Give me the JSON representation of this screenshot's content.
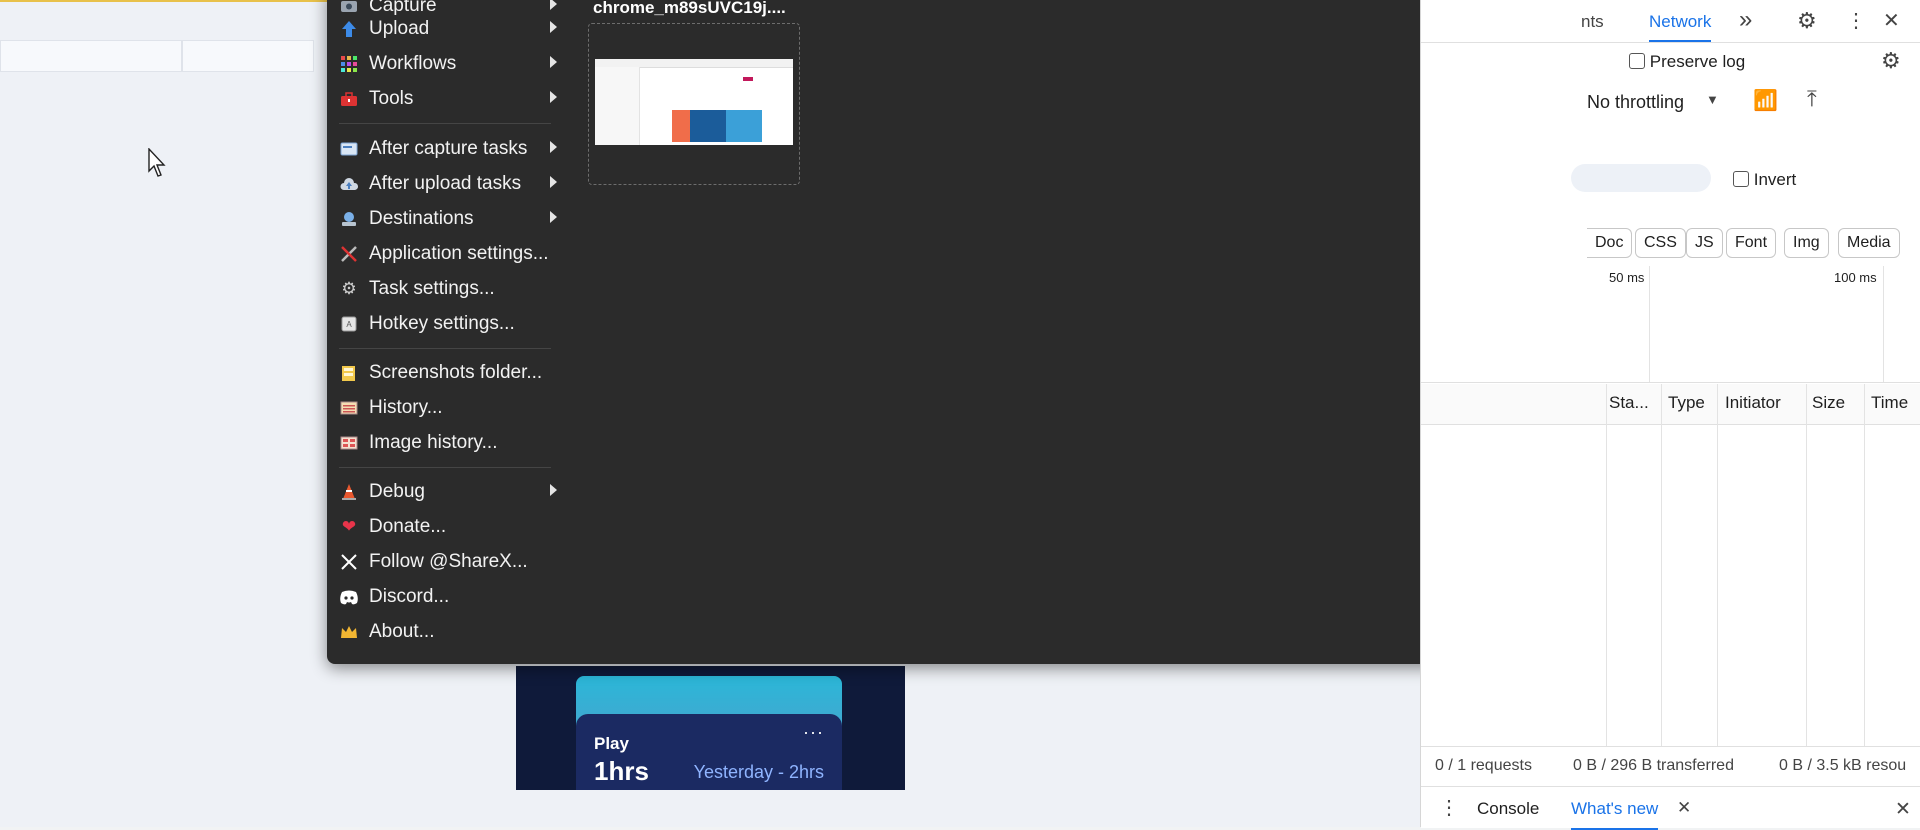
{
  "sharex_menu": {
    "items": [
      {
        "label": "Capture",
        "icon": "capture-icon",
        "submenu": true
      },
      {
        "label": "Upload",
        "icon": "upload-arrow-icon",
        "submenu": true
      },
      {
        "label": "Workflows",
        "icon": "workflows-grid-icon",
        "submenu": true
      },
      {
        "label": "Tools",
        "icon": "toolbox-icon",
        "submenu": true
      },
      {
        "label": "After capture tasks",
        "icon": "after-capture-icon",
        "submenu": true
      },
      {
        "label": "After upload tasks",
        "icon": "after-upload-cloud-icon",
        "submenu": true
      },
      {
        "label": "Destinations",
        "icon": "destinations-icon",
        "submenu": true
      },
      {
        "label": "Application settings...",
        "icon": "wrench-screwdriver-icon",
        "submenu": false
      },
      {
        "label": "Task settings...",
        "icon": "gear-icon",
        "submenu": false
      },
      {
        "label": "Hotkey settings...",
        "icon": "keyboard-key-icon",
        "submenu": false
      },
      {
        "label": "Screenshots folder...",
        "icon": "folder-icon",
        "submenu": false
      },
      {
        "label": "History...",
        "icon": "history-icon",
        "submenu": false
      },
      {
        "label": "Image history...",
        "icon": "image-history-icon",
        "submenu": false
      },
      {
        "label": "Debug",
        "icon": "debug-cone-icon",
        "submenu": true
      },
      {
        "label": "Donate...",
        "icon": "heart-icon",
        "submenu": false
      },
      {
        "label": "Follow @ShareX...",
        "icon": "x-logo-icon",
        "submenu": false
      },
      {
        "label": "Discord...",
        "icon": "discord-icon",
        "submenu": false
      },
      {
        "label": "About...",
        "icon": "crown-icon",
        "submenu": false
      }
    ],
    "thumbnail_title": "chrome_m89sUVC19j...."
  },
  "game_card": {
    "title": "Play",
    "hours": "1hrs",
    "yesterday": "Yesterday - 2hrs",
    "more": "···"
  },
  "devtools": {
    "tab_partial": "nts",
    "tab_network": "Network",
    "more_tabs": "»",
    "preserve_log": "Preserve log",
    "throttling": "No throttling",
    "invert": "Invert",
    "filter_chips": [
      "Doc",
      "CSS",
      "JS",
      "Font",
      "Img",
      "Media"
    ],
    "timeline_ticks": [
      "50 ms",
      "100 ms"
    ],
    "columns": [
      "Sta...",
      "Type",
      "Initiator",
      "Size",
      "Time"
    ],
    "status_requests": "0 / 1 requests",
    "status_transferred": "0 B / 296 B transferred",
    "status_resources": "0 B / 3.5 kB resou",
    "drawer_console": "Console",
    "drawer_whats_new": "What's new"
  }
}
